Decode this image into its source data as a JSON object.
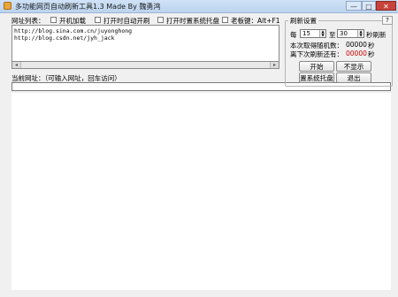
{
  "window": {
    "title": "多功能网页自动刷新工具1.3 Made By 魏勇鸿",
    "minimize_glyph": "—",
    "maximize_glyph": "□",
    "close_glyph": "✕"
  },
  "options": {
    "url_list_label": "网址列表：",
    "startup_label": "开机加载",
    "auto_refresh_label": "打开时自动开刷",
    "tray_label": "打开时置系统托盘",
    "hotkey_label": "老板键：Alt+F1"
  },
  "url_list": [
    "http://blog.sina.com.cn/juyonghong",
    "http://blog.csdn.net/jyh_jack"
  ],
  "scroll": {
    "left_glyph": "◂",
    "right_glyph": "▸"
  },
  "current_url": {
    "label": "当前网址：（可输入网址，回车访问）",
    "value": ""
  },
  "refresh_settings": {
    "title": "刷新设置",
    "help_glyph": "?",
    "every_label": "每",
    "min_value": "15",
    "to_label": "至",
    "max_value": "30",
    "unit_label": "秒刷新",
    "random_label": "本次取得随机数：",
    "random_value": "00000",
    "random_unit": "秒",
    "next_label": "离下次刷新还有：",
    "next_value": "00000",
    "next_unit": "秒",
    "spin_up": "▲",
    "spin_down": "▼"
  },
  "buttons": {
    "start": "开始",
    "hide": "不显示",
    "tray": "置系统托盘",
    "exit": "退出"
  },
  "colors": {
    "countdown": "#d10000"
  }
}
